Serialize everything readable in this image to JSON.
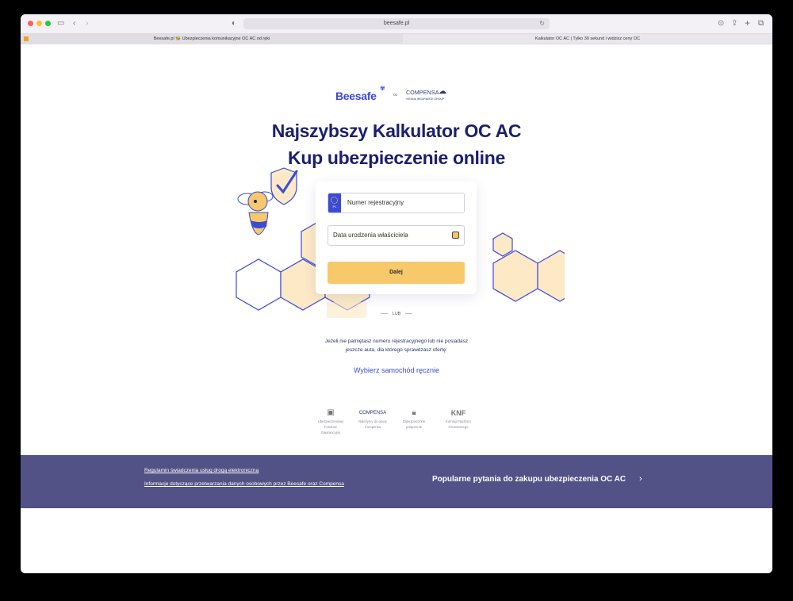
{
  "browser": {
    "url": "beesafe.pl",
    "tabs": [
      {
        "title": "Beesafe.pl 🐝 Ubezpieczenia komunikacyjne OC AC od ręki"
      },
      {
        "title": "Kalkulator OC AC | Tylko 30 sekund i widzisz ceny OC"
      }
    ]
  },
  "header": {
    "brand": "Beesafe",
    "connector": "oc",
    "partner": "COMPENSA",
    "partner_sub": "VIENNA INSURANCE GROUP"
  },
  "hero": {
    "title_line1": "Najszybszy Kalkulator OC AC",
    "title_line2": "Kup ubezpieczenie online"
  },
  "form": {
    "plate_country": "PL",
    "registration_placeholder": "Numer rejestracyjny",
    "birthdate_placeholder": "Data urodzenia właściciela",
    "submit_label": "Dalej"
  },
  "alt": {
    "or_label": "LUB",
    "help_line1": "Jeżeli nie pamiętasz numeru rejestracyjnego lub nie posiadasz",
    "help_line2": "jeszcze auta, dla którego sprawdzasz ofertę:",
    "manual_link": "Wybierz samochód ręcznie"
  },
  "badges": [
    {
      "icon": "ufg-icon",
      "label_line1": "Ubezpieczeniowy",
      "label_line2": "Fundusz",
      "label_line3": "Gwarancyjny"
    },
    {
      "icon": "compensa-icon",
      "label_line1": "Należymy do grupy",
      "label_line2": "Compensa",
      "label_line3": ""
    },
    {
      "icon": "lock-icon",
      "label_line1": "Zabezpieczone",
      "label_line2": "połączenie",
      "label_line3": ""
    },
    {
      "icon": "knf-icon",
      "label_line1": "Komisja Nadzoru",
      "label_line2": "Finansowego",
      "label_line3": ""
    }
  ],
  "footer": {
    "link1": "Regulamin świadczenia usług drogą elektroniczną",
    "link2": "Informacje dotyczące przetwarzania danych osobowych przez Beesafe oraz Compensa",
    "faq": "Popularne pytania do zakupu ubezpieczenia OC AC"
  },
  "colors": {
    "brand_blue": "#3b4bd8",
    "title_navy": "#1a1f6e",
    "button_yellow": "#f7c96b",
    "footer_bg": "#525286"
  }
}
